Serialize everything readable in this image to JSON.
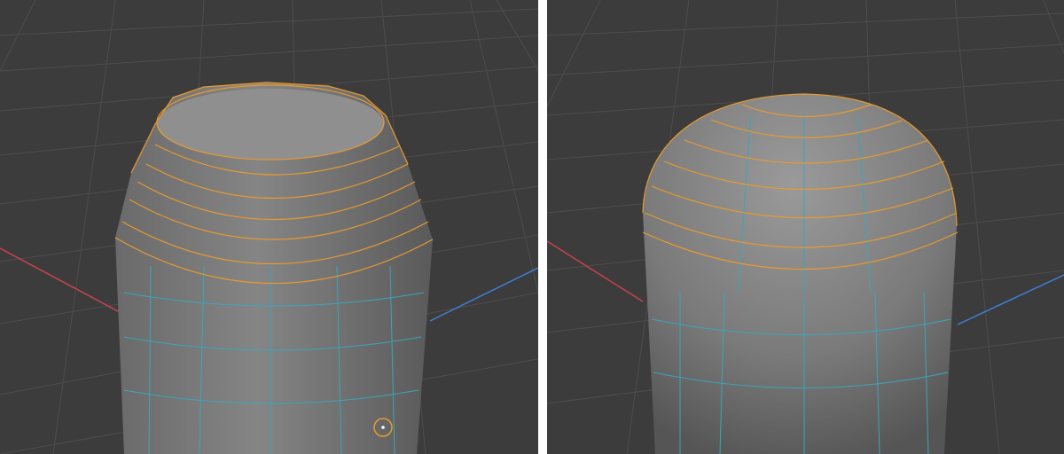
{
  "panels": [
    {
      "id": "left",
      "label": "",
      "description_shown": false
    },
    {
      "id": "right",
      "label": "",
      "description_shown": false
    }
  ],
  "colors": {
    "background": "#3c3c3c",
    "grid": "#4e4e4e",
    "x_axis": "#c8434f",
    "y_axis": "#3f7fd4",
    "mesh_body": "#7a7a7a",
    "mesh_edge": "#3aa6b9",
    "selected_edge": "#e79a2f",
    "cursor": "#e79a2f"
  },
  "viewport_left": {
    "has_3d_cursor": true,
    "shape": "cylinder-top-inset"
  },
  "viewport_right": {
    "has_3d_cursor": false,
    "shape": "cylinder-top-rounded"
  }
}
